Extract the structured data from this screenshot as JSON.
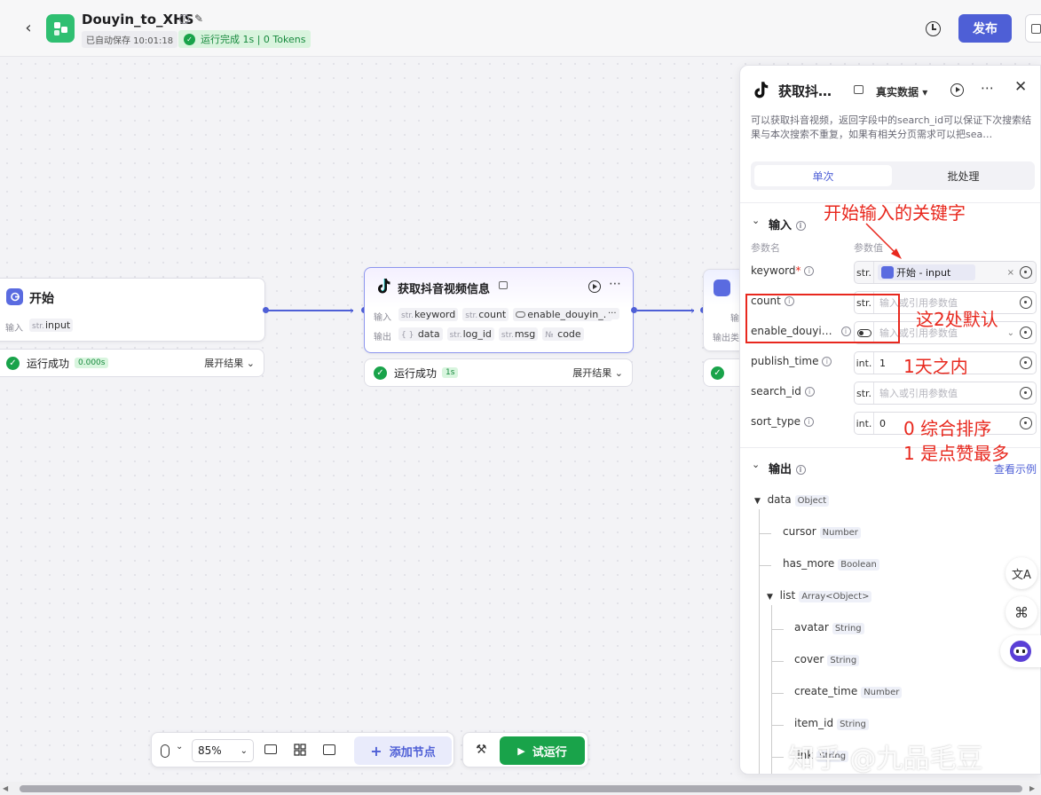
{
  "header": {
    "app_name": "Douyin_to_XHS",
    "autosave": "已自动保存 10:01:18",
    "run_status": "运行完成 1s | 0 Tokens",
    "publish_label": "发布"
  },
  "nodes": {
    "start": {
      "title": "开始",
      "input_label": "输入",
      "input_param": {
        "type": "str.",
        "name": "input"
      },
      "status": "运行成功",
      "duration": "0.000s",
      "expand": "展开结果"
    },
    "douyin": {
      "title": "获取抖音视频信息",
      "input_label": "输入",
      "output_label": "输出",
      "inputs": [
        {
          "type": "str.",
          "name": "keyword"
        },
        {
          "type": "str.",
          "name": "count"
        },
        {
          "type": "",
          "name": "enable_douyin_..."
        }
      ],
      "outputs": [
        {
          "type": "{ }",
          "name": "data"
        },
        {
          "type": "str.",
          "name": "log_id"
        },
        {
          "type": "str.",
          "name": "msg"
        },
        {
          "type": "№",
          "name": "code"
        }
      ],
      "status": "运行成功",
      "duration": "1s",
      "expand": "展开结果"
    },
    "third": {
      "input_label": "输",
      "output_label": "输出类"
    }
  },
  "panel": {
    "title": "获取抖…",
    "data_mode": "真实数据",
    "description": "可以获取抖音视频，返回字段中的search_id可以保证下次搜索结果与本次搜索不重复，如果有相关分页需求可以把sea…",
    "tabs": [
      "单次",
      "批处理"
    ],
    "input_section": "输入",
    "col_param_name": "参数名",
    "col_param_value": "参数值",
    "params": [
      {
        "name": "keyword",
        "required": true,
        "type": "str.",
        "value": "开始 - input",
        "is_ref": true
      },
      {
        "name": "count",
        "type": "str.",
        "placeholder": "输入或引用参数值"
      },
      {
        "name": "enable_douyi…",
        "type": "toggle",
        "placeholder": "输入或引用参数值"
      },
      {
        "name": "publish_time",
        "type": "int.",
        "value": "1"
      },
      {
        "name": "search_id",
        "type": "str.",
        "placeholder": "输入或引用参数值"
      },
      {
        "name": "sort_type",
        "type": "int.",
        "value": "0"
      }
    ],
    "output_section": "输出",
    "view_example": "查看示例",
    "output_tree": [
      {
        "name": "data",
        "type": "Object"
      },
      {
        "name": "cursor",
        "type": "Number"
      },
      {
        "name": "has_more",
        "type": "Boolean"
      },
      {
        "name": "list",
        "type": "Array<Object>"
      },
      {
        "name": "avatar",
        "type": "String"
      },
      {
        "name": "cover",
        "type": "String"
      },
      {
        "name": "create_time",
        "type": "Number"
      },
      {
        "name": "item_id",
        "type": "String"
      },
      {
        "name": "link",
        "type": "String"
      }
    ]
  },
  "annotations": {
    "keyword_note": "开始输入的关键字",
    "default_note": "这2处默认",
    "publish_note": "1天之内",
    "sort_note_1": "0 综合排序",
    "sort_note_2": "1 是点赞最多"
  },
  "toolbar": {
    "zoom": "85%",
    "add_node": "添加节点",
    "test_run": "试运行"
  },
  "watermark": "知乎 @九品毛豆",
  "colors": {
    "accent": "#4e5fd6",
    "success": "#19a34a",
    "annotation": "#e8281e"
  }
}
